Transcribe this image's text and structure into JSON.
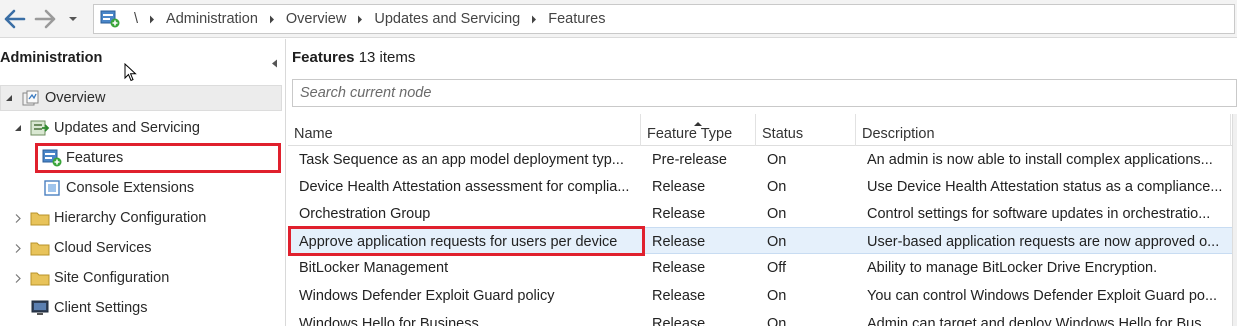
{
  "nav": {
    "back_icon": "arrow-left-icon",
    "forward_icon": "arrow-right-icon",
    "history_icon": "chevron-down-icon",
    "breadcrumb": [
      "\\",
      "Administration",
      "Overview",
      "Updates and Servicing",
      "Features"
    ]
  },
  "left": {
    "title": "Administration",
    "tree": [
      {
        "label": "Overview",
        "icon": "overview-icon"
      },
      {
        "label": "Updates and Servicing",
        "icon": "updates-servicing-icon"
      },
      {
        "label": "Features",
        "icon": "features-icon"
      },
      {
        "label": "Console Extensions",
        "icon": "console-extensions-icon"
      },
      {
        "label": "Hierarchy Configuration",
        "icon": "folder-icon"
      },
      {
        "label": "Cloud Services",
        "icon": "folder-icon"
      },
      {
        "label": "Site Configuration",
        "icon": "folder-icon"
      },
      {
        "label": "Client Settings",
        "icon": "client-settings-icon"
      }
    ]
  },
  "content": {
    "title": "Features",
    "count": "13 items",
    "search_placeholder": "Search current node",
    "columns": {
      "name": "Name",
      "type": "Feature Type",
      "status": "Status",
      "desc": "Description"
    },
    "rows": [
      {
        "name": "Task Sequence as an app model deployment typ...",
        "type": "Pre-release",
        "status": "On",
        "desc": "An admin is now able to install complex applications..."
      },
      {
        "name": "Device Health Attestation assessment for complia...",
        "type": "Release",
        "status": "On",
        "desc": "Use Device Health Attestation status as a compliance..."
      },
      {
        "name": "Orchestration Group",
        "type": "Release",
        "status": "On",
        "desc": "Control settings for software updates in orchestratio..."
      },
      {
        "name": "Approve application requests for users per device",
        "type": "Release",
        "status": "On",
        "desc": "User-based application requests are now approved o..."
      },
      {
        "name": "BitLocker Management",
        "type": "Release",
        "status": "Off",
        "desc": "Ability to manage BitLocker Drive Encryption."
      },
      {
        "name": "Windows Defender Exploit Guard policy",
        "type": "Release",
        "status": "On",
        "desc": "You can control Windows Defender Exploit Guard po..."
      },
      {
        "name": "Windows Hello for Business",
        "type": "Release",
        "status": "On",
        "desc": "Admin can target and deploy Windows Hello for Bus..."
      }
    ]
  },
  "colors": {
    "highlight": "#e0202d",
    "selected_row": "#e5f0fb",
    "folder": "#e8c35a"
  }
}
